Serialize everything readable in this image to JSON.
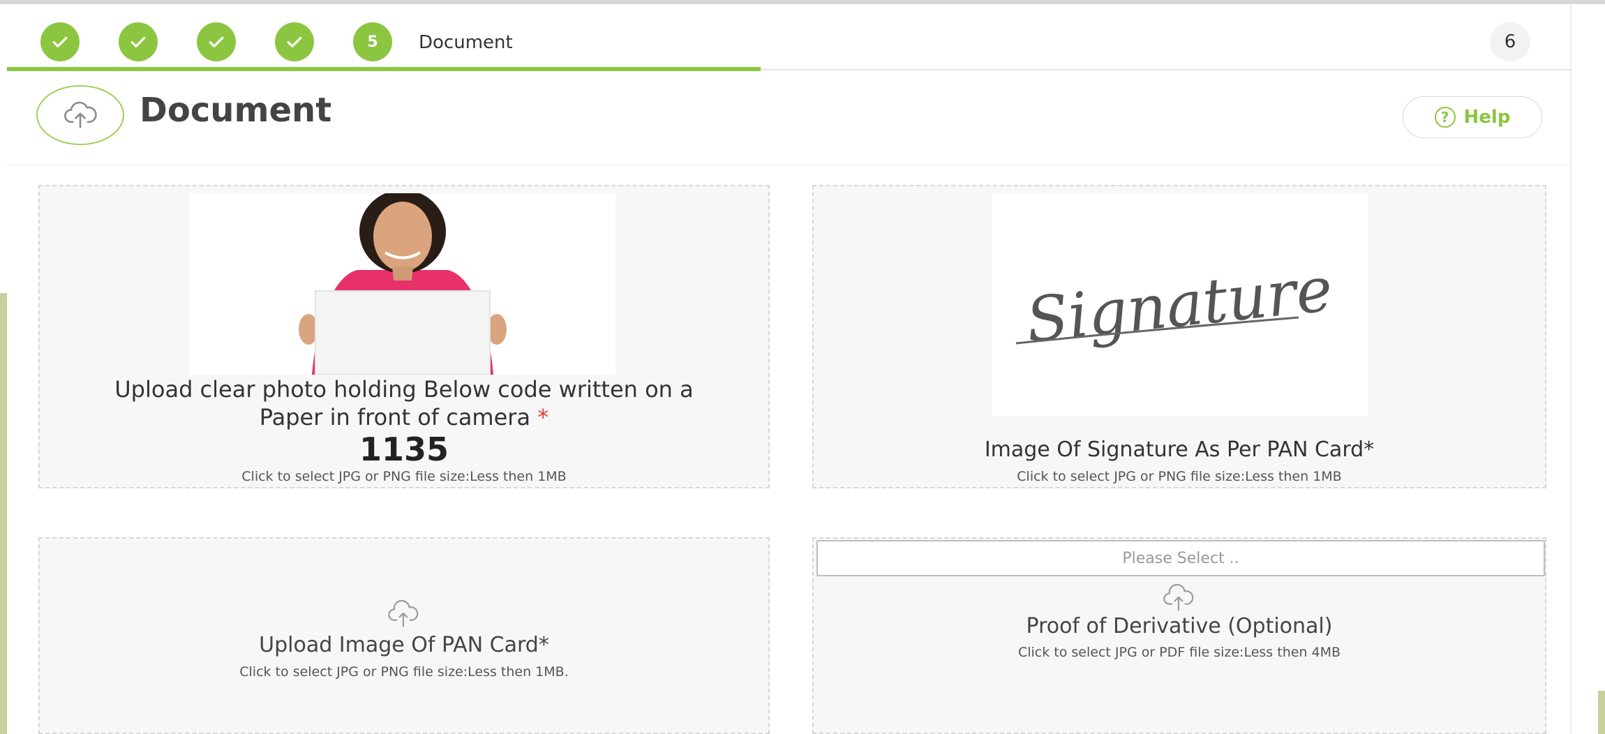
{
  "stepper": {
    "current_step_number": "5",
    "current_step_label": "Document",
    "last_step_number": "6",
    "completed_steps": 4,
    "progress_fraction": 0.48
  },
  "header": {
    "title": "Document",
    "help_label": "Help",
    "help_icon_glyph": "?"
  },
  "uploads": {
    "photo": {
      "instruction_line1": "Upload clear photo holding Below code written on a",
      "instruction_line2": "Paper in front of camera",
      "required_mark": "*",
      "code": "1135",
      "hint": "Click to select JPG or PNG file size:Less then 1MB"
    },
    "signature": {
      "sample_text": "Signature",
      "label": "Image Of Signature As Per PAN Card*",
      "hint": "Click to select JPG or PNG file size:Less then 1MB"
    },
    "pan_card": {
      "label": "Upload Image Of PAN Card*",
      "hint": "Click to select JPG or PNG file size:Less then 1MB."
    },
    "derivative": {
      "select_placeholder": "Please Select ..",
      "label": "Proof of Derivative (Optional)",
      "hint": "Click to select JPG or PDF file size:Less then 4MB"
    }
  },
  "colors": {
    "accent_green": "#8cc641",
    "panel_bg": "#f7f7f7",
    "required_red": "#e0433a"
  },
  "icons": [
    "check-icon",
    "upload-cloud-icon",
    "help-circle-icon"
  ]
}
